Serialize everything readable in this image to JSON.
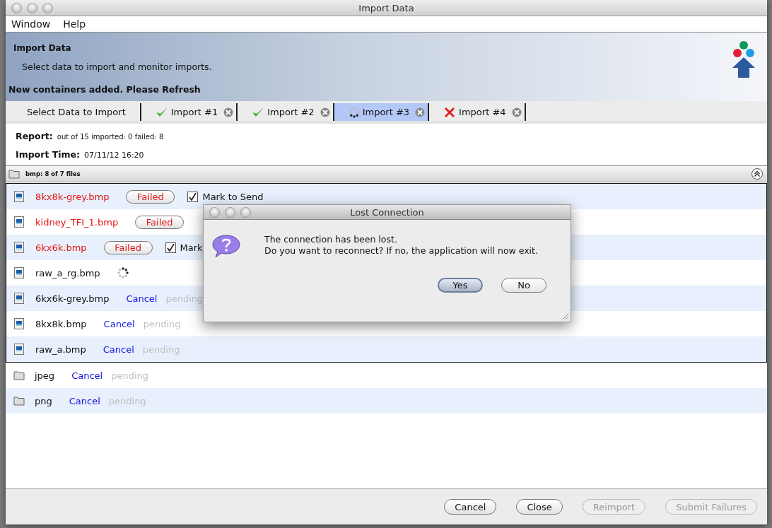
{
  "window": {
    "title": "Import Data"
  },
  "menu": [
    "Window",
    "Help"
  ],
  "header": {
    "title": "Import Data",
    "subtitle": "Select data to import and monitor imports.",
    "notice": "New containers added. Please Refresh"
  },
  "tabs": [
    {
      "label": "Select Data to Import",
      "kind": "plain",
      "closable": false,
      "selected": false
    },
    {
      "label": "Import #1",
      "kind": "done",
      "closable": true,
      "selected": false
    },
    {
      "label": "Import #2",
      "kind": "done",
      "closable": true,
      "selected": false
    },
    {
      "label": "Import #3",
      "kind": "running",
      "closable": true,
      "selected": true
    },
    {
      "label": "Import #4",
      "kind": "error",
      "closable": true,
      "selected": false
    }
  ],
  "report": [
    {
      "label": "Report:",
      "value": "out of 15 imported: 0 failed: 8"
    },
    {
      "label": "Import Time:",
      "value": "07/11/12 16:20"
    }
  ],
  "group": {
    "title": "bmp: 8 of 7 files",
    "expanded": true
  },
  "files": [
    {
      "name": "8kx8k-grey.bmp",
      "kind": "failed",
      "action": "Failed",
      "checked": true,
      "mark_label": "Mark to Send"
    },
    {
      "name": "kidney_TFI_1.bmp",
      "kind": "failed",
      "action": "Failed"
    },
    {
      "name": "6kx6k.bmp",
      "kind": "failed",
      "action": "Failed",
      "checked": true,
      "mark_label": "Mark"
    },
    {
      "name": "raw_a_rg.bmp",
      "kind": "progress"
    },
    {
      "name": "6kx6k-grey.bmp",
      "kind": "pending",
      "action": "Cancel",
      "status": "pending"
    },
    {
      "name": "8kx8k.bmp",
      "kind": "pending",
      "action": "Cancel",
      "status": "pending"
    },
    {
      "name": "raw_a.bmp",
      "kind": "pending",
      "action": "Cancel",
      "status": "pending"
    }
  ],
  "folders": [
    {
      "name": "jpeg",
      "action": "Cancel",
      "status": "pending"
    },
    {
      "name": "png",
      "action": "Cancel",
      "status": "pending"
    }
  ],
  "buttons": [
    {
      "label": "Cancel",
      "disabled": false
    },
    {
      "label": "Close",
      "disabled": false
    },
    {
      "label": "Reimport",
      "disabled": true
    },
    {
      "label": "Submit Failures",
      "disabled": true
    }
  ],
  "dialog": {
    "title": "Lost Connection",
    "message": [
      "The connection has been lost.",
      "Do you want to reconnect? If no, the application will now exit."
    ],
    "buttons": [
      {
        "label": "Yes",
        "selected": true
      },
      {
        "label": "No",
        "selected": false
      }
    ]
  }
}
